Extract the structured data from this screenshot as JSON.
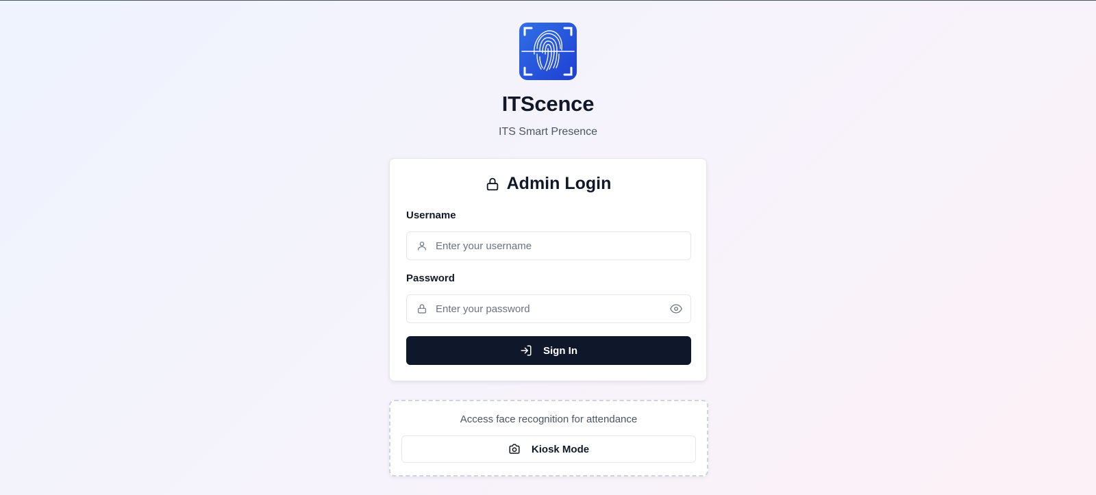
{
  "app": {
    "name": "ITScence",
    "tagline": "ITS Smart Presence",
    "logo_icon": "fingerprint-scan-icon"
  },
  "login": {
    "title": "Admin Login",
    "title_icon": "lock-icon",
    "username": {
      "label": "Username",
      "placeholder": "Enter your username",
      "value": "",
      "icon": "user-icon"
    },
    "password": {
      "label": "Password",
      "placeholder": "Enter your password",
      "value": "",
      "icon": "lock-icon",
      "toggle_icon": "eye-icon"
    },
    "submit": {
      "label": "Sign In",
      "icon": "log-in-icon"
    }
  },
  "kiosk": {
    "description": "Access face recognition for attendance",
    "button_label": "Kiosk Mode",
    "button_icon": "camera-icon"
  },
  "colors": {
    "primary_button": "#0f172a",
    "logo_gradient_start": "#2f6fe6",
    "logo_gradient_end": "#1f3fd2",
    "muted_text": "#4b5563"
  }
}
